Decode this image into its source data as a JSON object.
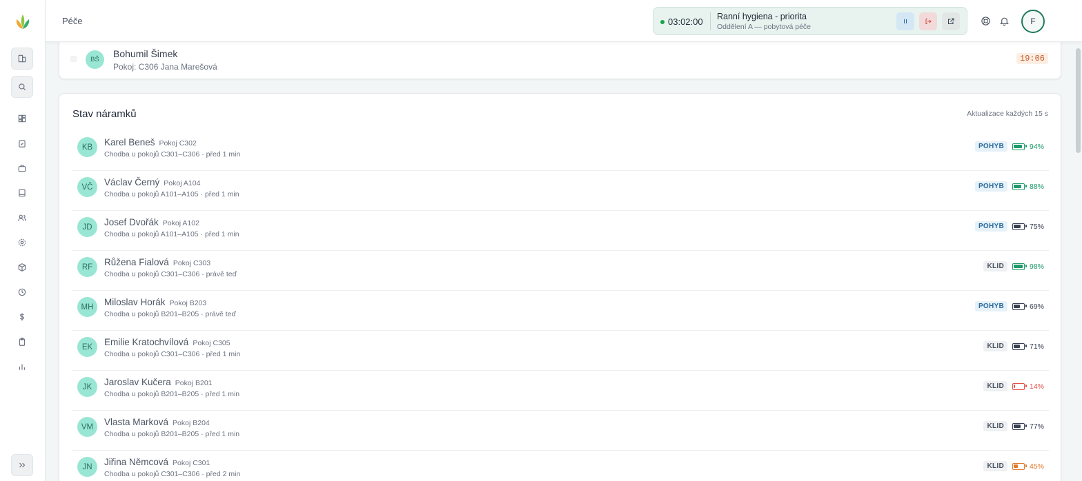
{
  "header": {
    "title": "Péče",
    "timer": {
      "time": "03:02:00",
      "task": "Ranní hygiena - priorita",
      "department": "Oddělení A — pobytová péče"
    },
    "user_initial": "F"
  },
  "sidebar": {
    "icons": [
      "building-icon",
      "search-icon",
      "dashboard-icon",
      "clipboard-check-icon",
      "briefcase-icon",
      "book-icon",
      "users-icon",
      "settings-icon",
      "package-icon",
      "clock-icon",
      "dollar-icon",
      "clipboard-icon",
      "bar-chart-icon"
    ]
  },
  "top_card": {
    "checkbox": false,
    "initials": "BŠ",
    "name": "Bohumil Šimek",
    "subtitle": "Pokoj: C306  Jana Marešová",
    "time": "19:06"
  },
  "bracelets": {
    "title": "Stav náramků",
    "update_note": "Aktualizace každých 15 s",
    "rows": [
      {
        "initials": "KB",
        "name": "Karel Beneš",
        "room": "Pokoj C302",
        "location": "Chodba u pokojů C301–C306 · před 1 min",
        "status": "POHYB",
        "battery": "94%",
        "battery_level": 94,
        "battery_color": "#1f9a6a"
      },
      {
        "initials": "VČ",
        "name": "Václav Černý",
        "room": "Pokoj A104",
        "location": "Chodba u pokojů A101–A105 · před 1 min",
        "status": "POHYB",
        "battery": "88%",
        "battery_level": 88,
        "battery_color": "#1f9a6a"
      },
      {
        "initials": "JD",
        "name": "Josef Dvořák",
        "room": "Pokoj A102",
        "location": "Chodba u pokojů A101–A105 · před 1 min",
        "status": "POHYB",
        "battery": "75%",
        "battery_level": 75,
        "battery_color": "#374151"
      },
      {
        "initials": "RF",
        "name": "Růžena Fialová",
        "room": "Pokoj C303",
        "location": "Chodba u pokojů C301–C306 · právě teď",
        "status": "KLID",
        "battery": "98%",
        "battery_level": 98,
        "battery_color": "#1f9a6a"
      },
      {
        "initials": "MH",
        "name": "Miloslav Horák",
        "room": "Pokoj B203",
        "location": "Chodba u pokojů B201–B205 · právě teď",
        "status": "POHYB",
        "battery": "69%",
        "battery_level": 69,
        "battery_color": "#374151"
      },
      {
        "initials": "EK",
        "name": "Emilie Kratochvílová",
        "room": "Pokoj C305",
        "location": "Chodba u pokojů C301–C306 · před 1 min",
        "status": "KLID",
        "battery": "71%",
        "battery_level": 71,
        "battery_color": "#374151"
      },
      {
        "initials": "JK",
        "name": "Jaroslav Kučera",
        "room": "Pokoj B201",
        "location": "Chodba u pokojů B201–B205 · před 1 min",
        "status": "KLID",
        "battery": "14%",
        "battery_level": 14,
        "battery_color": "#e0524a"
      },
      {
        "initials": "VM",
        "name": "Vlasta Marková",
        "room": "Pokoj B204",
        "location": "Chodba u pokojů B201–B205 · před 1 min",
        "status": "KLID",
        "battery": "77%",
        "battery_level": 77,
        "battery_color": "#374151"
      },
      {
        "initials": "JN",
        "name": "Jiřina Němcová",
        "room": "Pokoj C301",
        "location": "Chodba u pokojů C301–C306 · před 2 min",
        "status": "KLID",
        "battery": "45%",
        "battery_level": 45,
        "battery_color": "#e07a2a"
      }
    ]
  },
  "colors": {
    "accent": "#1f7a5a",
    "avatar_bg": "#99e6d4",
    "battery_good": "#1f9a6a",
    "battery_low": "#e0524a",
    "battery_mid": "#e07a2a"
  }
}
